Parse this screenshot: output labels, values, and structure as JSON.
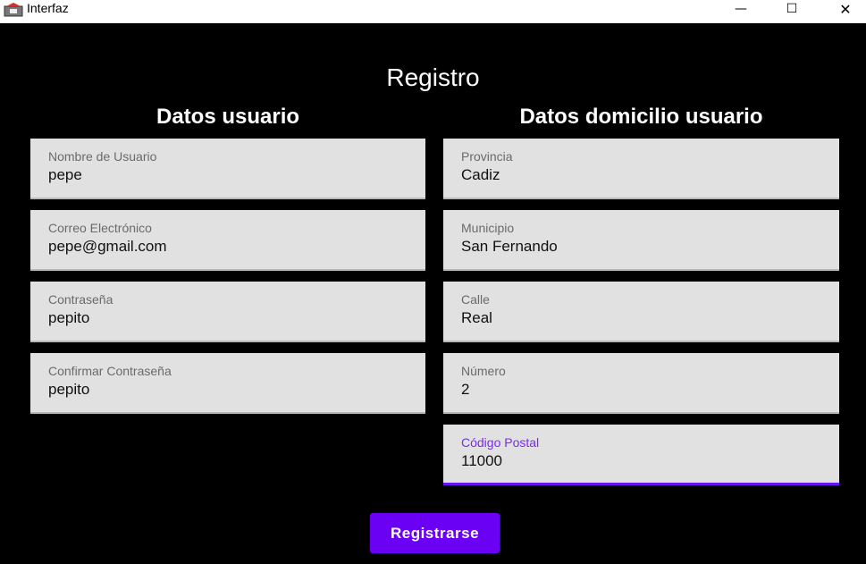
{
  "window": {
    "title": "Interfaz",
    "minimize_glyph": "—",
    "maximize_glyph": "☐",
    "close_glyph": "✕"
  },
  "form": {
    "title": "Registro",
    "left_heading": "Datos usuario",
    "right_heading": "Datos domicilio usuario",
    "user_fields": [
      {
        "label": "Nombre de Usuario",
        "value": "pepe"
      },
      {
        "label": "Correo Electrónico",
        "value": "pepe@gmail.com"
      },
      {
        "label": "Contraseña",
        "value": "pepito"
      },
      {
        "label": "Confirmar Contraseña",
        "value": "pepito"
      }
    ],
    "address_fields": [
      {
        "label": "Provincia",
        "value": "Cadiz"
      },
      {
        "label": "Municipio",
        "value": "San Fernando"
      },
      {
        "label": "Calle",
        "value": "Real"
      },
      {
        "label": "Número",
        "value": "2"
      },
      {
        "label": "Código Postal",
        "value": "11000"
      }
    ],
    "submit_label": "Registrarse"
  },
  "colors": {
    "accent": "#6a00f4",
    "background": "#000000",
    "field_bg": "#e1e1e1"
  }
}
